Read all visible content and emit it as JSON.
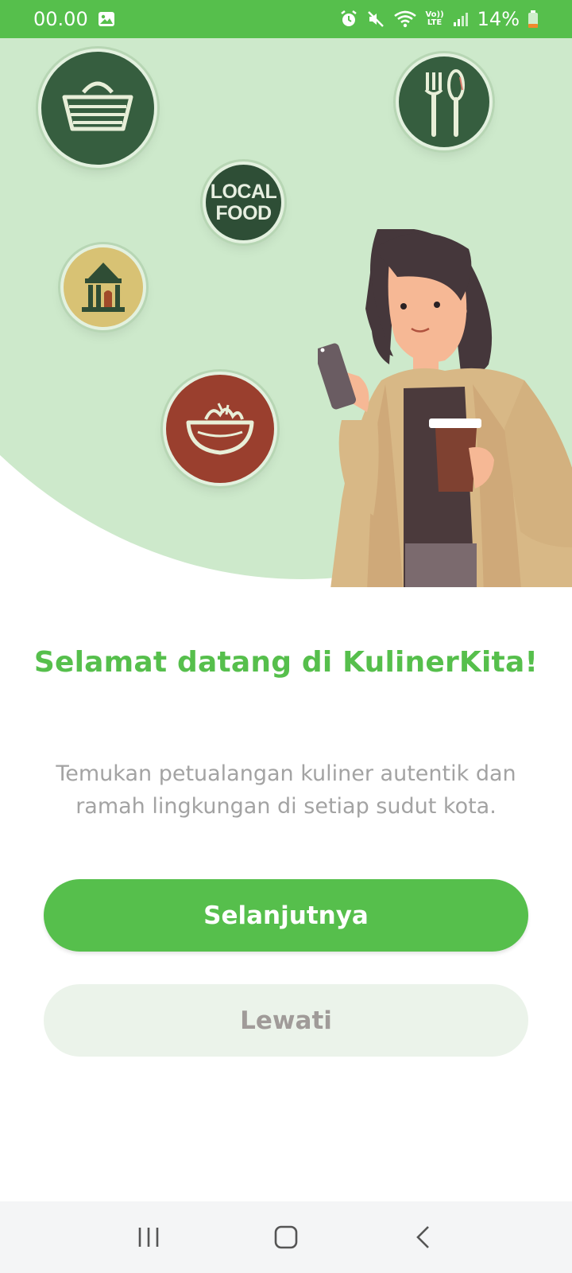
{
  "status_bar": {
    "time": "00.00",
    "battery": "14%",
    "icons": [
      "image-icon",
      "alarm-icon",
      "mute-icon",
      "wifi-icon",
      "volte-icon",
      "signal-icon",
      "battery-icon"
    ],
    "volte_text_top": "Vo))",
    "volte_text_bottom": "LTE"
  },
  "hero": {
    "local_food_line1": "LOCAL",
    "local_food_line2": "FOOD",
    "badges": [
      "basket-icon",
      "cutlery-icon",
      "local-food-badge",
      "temple-icon",
      "bowl-icon"
    ],
    "illustration": "woman-with-phone-and-coffee"
  },
  "onboarding": {
    "title": "Selamat datang di KulinerKita!",
    "subtitle": "Temukan petualangan kuliner autentik dan ramah lingkungan di setiap sudut kota.",
    "next_label": "Selanjutnya",
    "skip_label": "Lewati"
  },
  "nav": {
    "icons": [
      "recent-apps-icon",
      "home-icon",
      "back-icon"
    ]
  },
  "colors": {
    "brand_green": "#56bf4c",
    "hero_bg": "#cde9cb",
    "skip_bg": "#ebf3ea",
    "subtitle_gray": "#a3a3a3"
  }
}
